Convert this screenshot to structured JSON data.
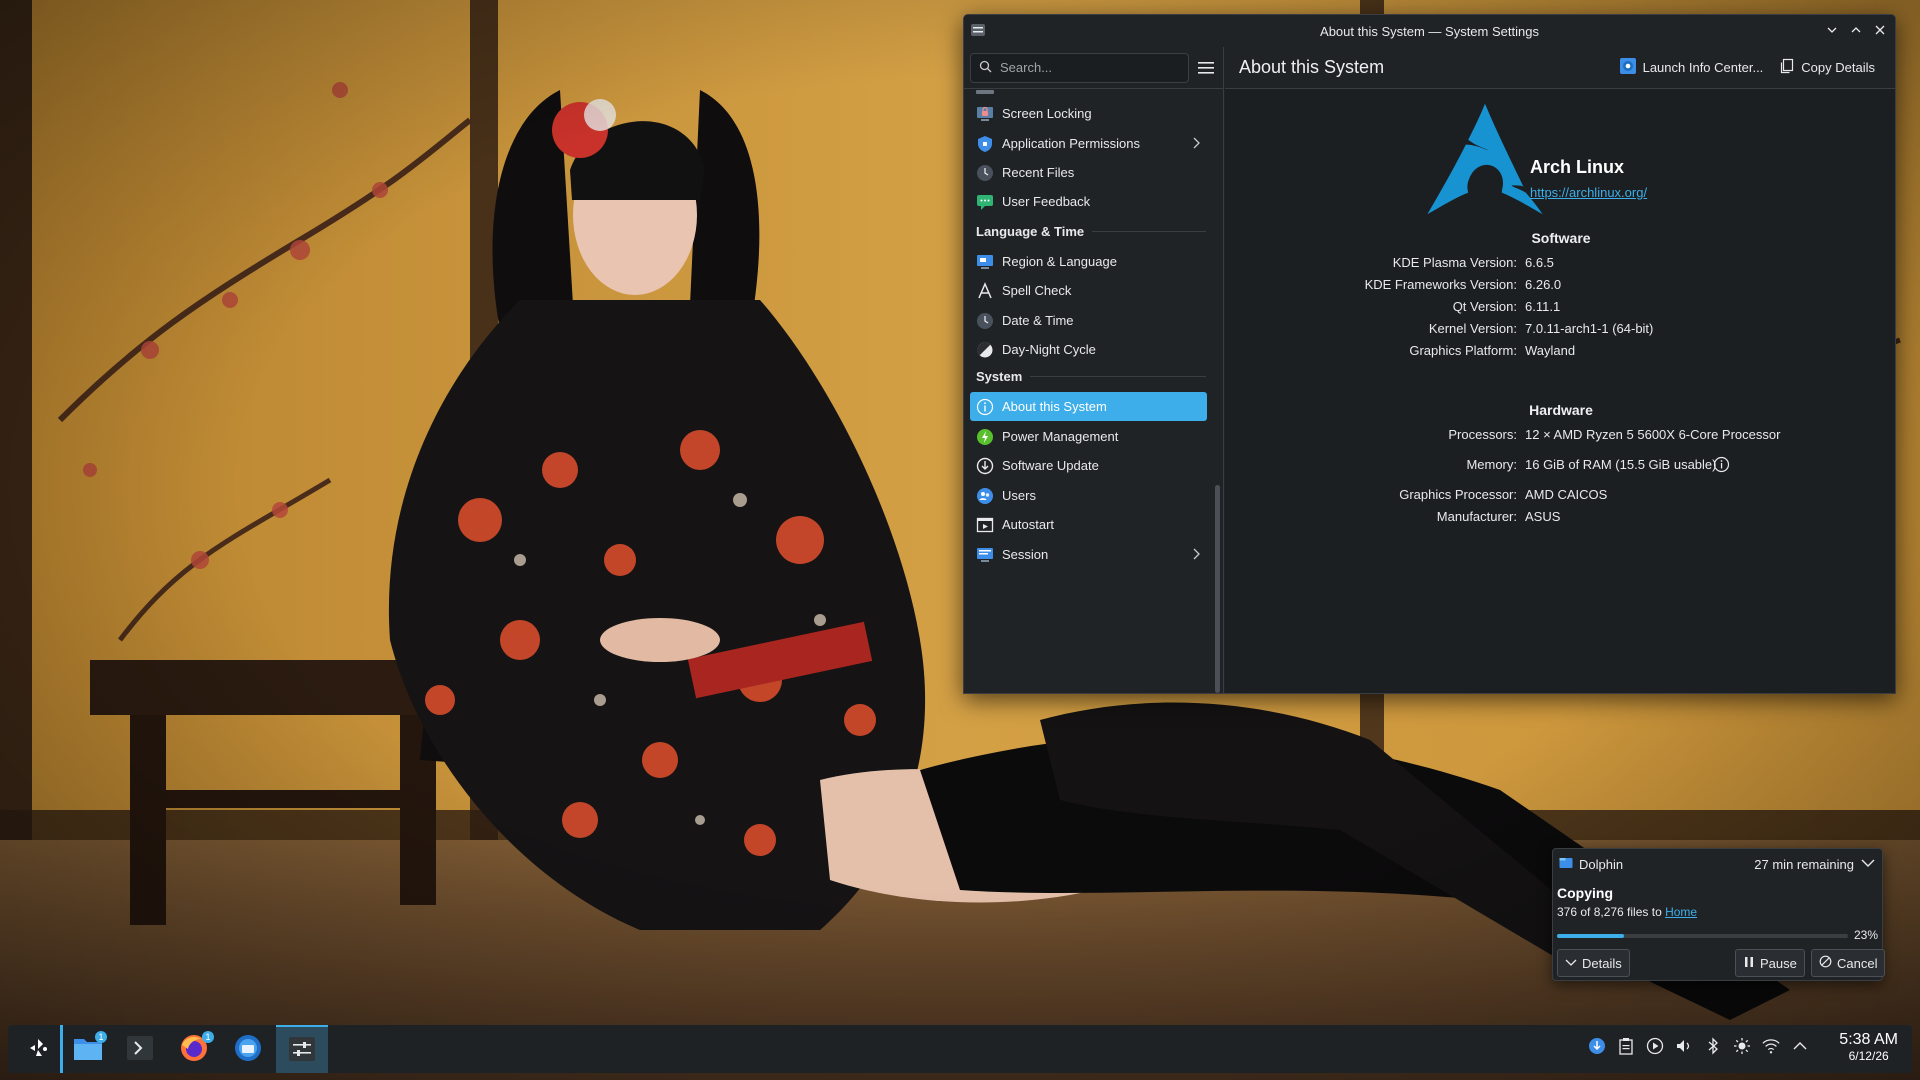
{
  "window": {
    "title": "About this System — System Settings"
  },
  "sidebar": {
    "search_placeholder": "Search...",
    "items": [
      {
        "label": "Screen Locking",
        "icon": "screen-lock-icon"
      },
      {
        "label": "Application Permissions",
        "icon": "shield-icon",
        "has_children": true
      },
      {
        "label": "Recent Files",
        "icon": "clock-icon"
      },
      {
        "label": "User Feedback",
        "icon": "chat-bubble-icon"
      }
    ],
    "section_language": "Language & Time",
    "language_items": [
      {
        "label": "Region & Language",
        "icon": "monitor-flag-icon"
      },
      {
        "label": "Spell Check",
        "icon": "spell-check-icon"
      },
      {
        "label": "Date & Time",
        "icon": "clock-icon"
      },
      {
        "label": "Day-Night Cycle",
        "icon": "day-night-icon"
      }
    ],
    "section_system": "System",
    "system_items": [
      {
        "label": "About this System",
        "icon": "info-icon",
        "selected": true
      },
      {
        "label": "Power Management",
        "icon": "power-icon"
      },
      {
        "label": "Software Update",
        "icon": "update-icon"
      },
      {
        "label": "Users",
        "icon": "users-icon"
      },
      {
        "label": "Autostart",
        "icon": "autostart-icon"
      },
      {
        "label": "Session",
        "icon": "session-icon",
        "has_children": true
      }
    ]
  },
  "content": {
    "page_title": "About this System",
    "launch_info_label": "Launch Info Center...",
    "copy_details_label": "Copy Details",
    "distro_name": "Arch Linux",
    "distro_url": "https://archlinux.org/",
    "software_title": "Software",
    "software": [
      {
        "key": "KDE Plasma Version:",
        "value": "6.6.5"
      },
      {
        "key": "KDE Frameworks Version:",
        "value": "6.26.0"
      },
      {
        "key": "Qt Version:",
        "value": "6.11.1"
      },
      {
        "key": "Kernel Version:",
        "value": "7.0.11-arch1-1 (64-bit)"
      },
      {
        "key": "Graphics Platform:",
        "value": "Wayland"
      }
    ],
    "hardware_title": "Hardware",
    "hardware": [
      {
        "key": "Processors:",
        "value": "12 × AMD Ryzen 5 5600X 6-Core Processor"
      },
      {
        "key": "Memory:",
        "value": "16 GiB of RAM (15.5 GiB usable)"
      },
      {
        "key": "Graphics Processor:",
        "value": "AMD CAICOS"
      },
      {
        "key": "Manufacturer:",
        "value": "ASUS"
      }
    ]
  },
  "notification": {
    "app": "Dolphin",
    "remaining": "27 min remaining",
    "title": "Copying",
    "body_prefix": "376 of 8,276 files to ",
    "body_link": "Home",
    "progress_percent": 23,
    "progress_label": "23%",
    "details_label": "Details",
    "pause_label": "Pause",
    "cancel_label": "Cancel"
  },
  "taskbar": {
    "file_manager_badge": "1",
    "firefox_badge": "1",
    "time": "5:38 AM",
    "date": "6/12/26"
  },
  "colors": {
    "accent": "#3daee9",
    "window_bg": "#202326",
    "content_bg": "#1c1f22"
  }
}
